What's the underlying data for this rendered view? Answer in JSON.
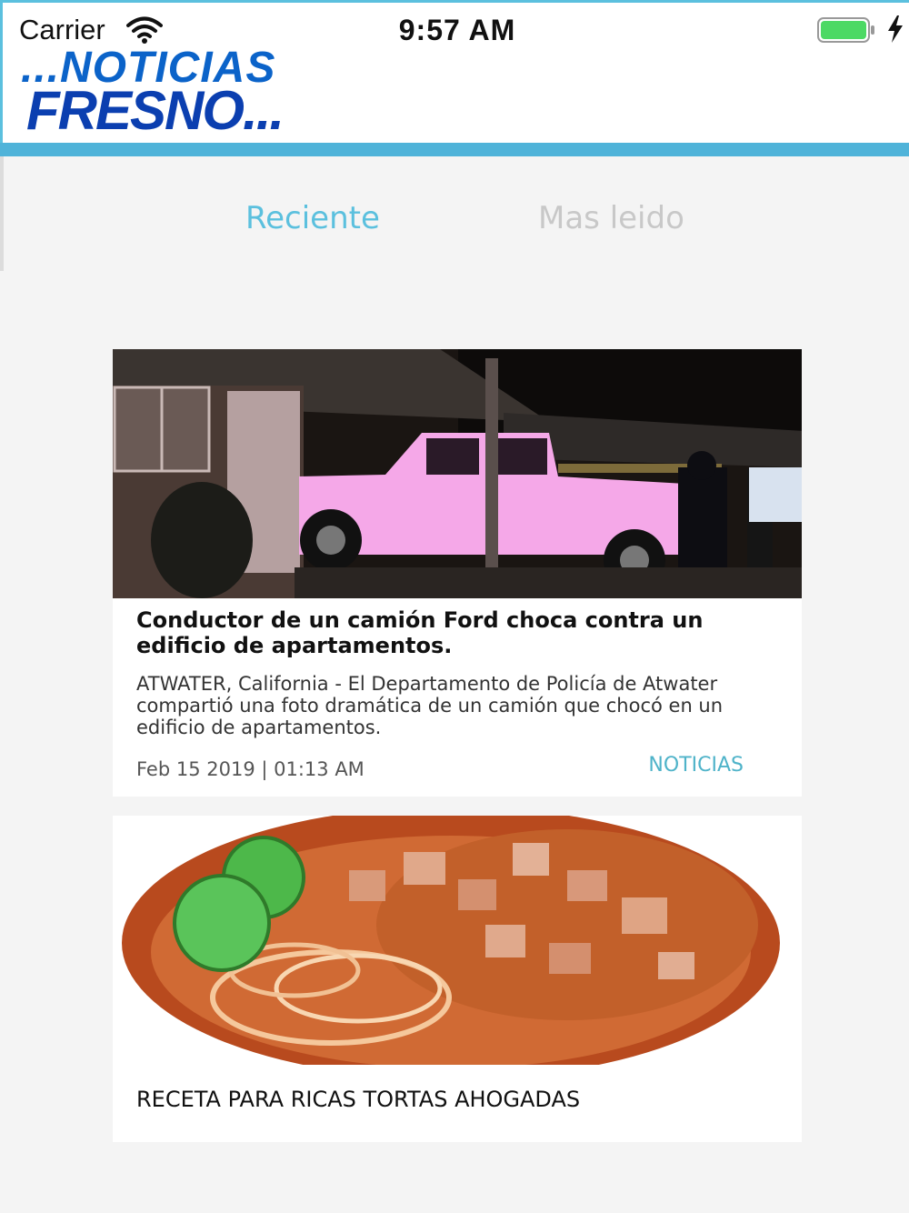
{
  "status_bar": {
    "carrier": "Carrier",
    "time": "9:57 AM",
    "icons": [
      "wifi-icon",
      "battery-icon",
      "charging-bolt-icon"
    ]
  },
  "app": {
    "logo_line1": "...NOTICIAS",
    "logo_line2": "FRESNO...",
    "accent_color": "#5bc0de",
    "logo_color": "#0b4fc0"
  },
  "tabs": [
    {
      "label": "Reciente",
      "active": true
    },
    {
      "label": "Mas leido",
      "active": false
    }
  ],
  "articles": [
    {
      "image": "pickup-truck-crash-photo",
      "title": "Conductor de un camión Ford choca contra un edificio de apartamentos.",
      "summary": "ATWATER, California - El Departamento de Policía de Atwater compartió una foto dramática de un camión que chocó en un edificio de apartamentos.",
      "date": "Feb 15 2019 | 01:13 AM",
      "category": "NOTICIAS"
    },
    {
      "image": "tortas-ahogadas-photo",
      "title": "RECETA PARA RICAS TORTAS AHOGADAS"
    }
  ]
}
